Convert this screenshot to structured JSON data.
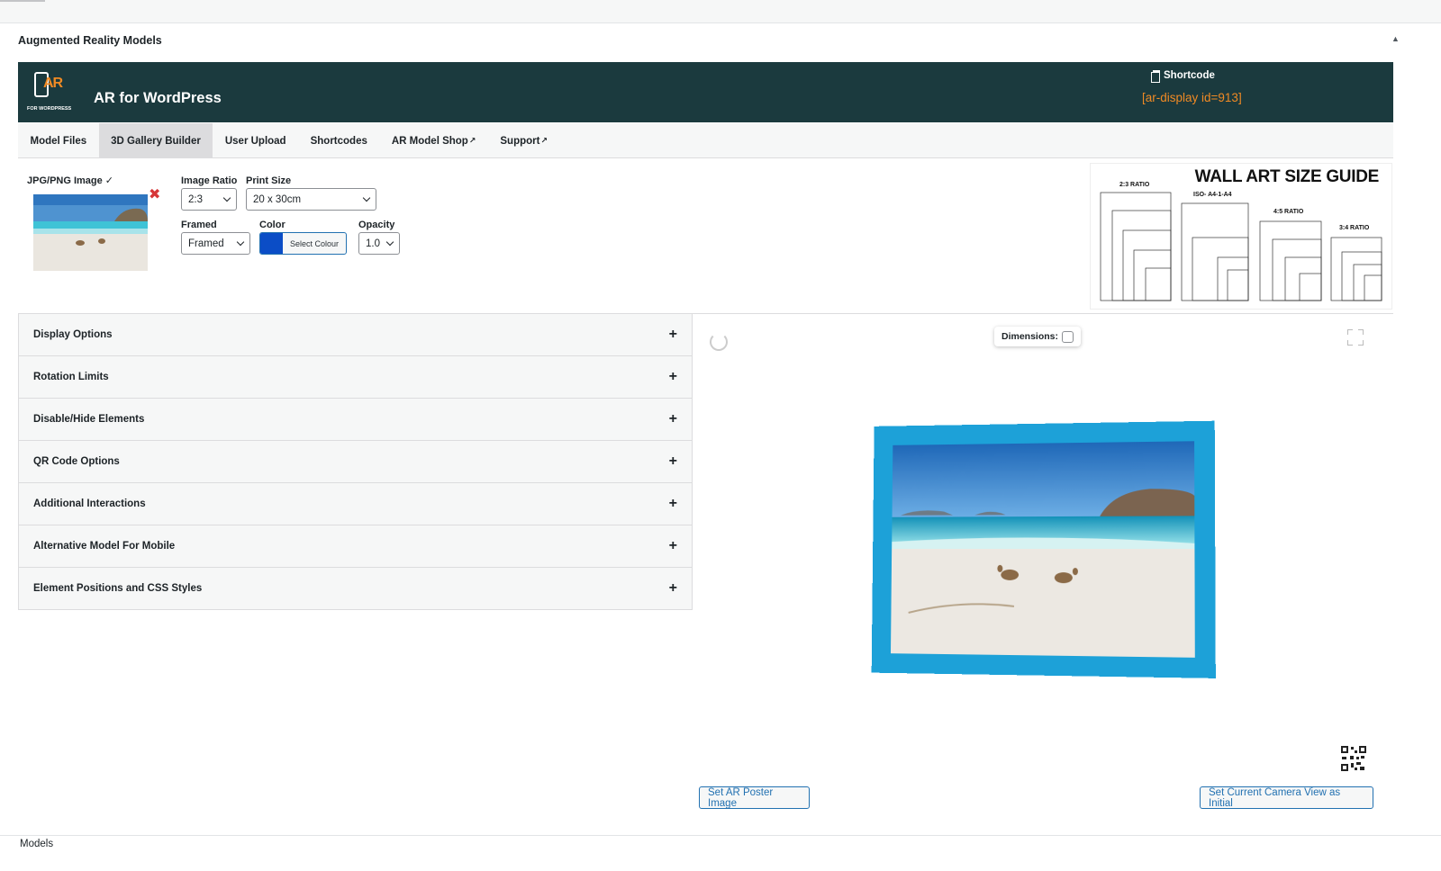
{
  "panel": {
    "title": "Augmented Reality Models",
    "collapse_icon": "triangle-up-icon"
  },
  "header": {
    "logo_text": "AR",
    "logo_sub": "FOR WORDPRESS",
    "title": "AR for WordPress",
    "shortcode_label": "Shortcode",
    "shortcode_value": "[ar-display id=913]",
    "bg_color": "#1b3a3e",
    "accent_color": "#f08a24"
  },
  "tabs": [
    {
      "label": "Model Files",
      "active": false,
      "external": false
    },
    {
      "label": "3D Gallery Builder",
      "active": true,
      "external": false
    },
    {
      "label": "User Upload",
      "active": false,
      "external": false
    },
    {
      "label": "Shortcodes",
      "active": false,
      "external": false
    },
    {
      "label": "AR Model Shop",
      "active": false,
      "external": true
    },
    {
      "label": "Support",
      "active": false,
      "external": true
    }
  ],
  "builder": {
    "image_label": "JPG/PNG Image ✓",
    "image_ratio_label": "Image Ratio",
    "image_ratio_value": "2:3",
    "print_size_label": "Print Size",
    "print_size_value": "20 x 30cm",
    "framed_label": "Framed",
    "framed_value": "Framed",
    "color_label": "Color",
    "color_button": "Select Colour",
    "color_value": "#0b4dc6",
    "opacity_label": "Opacity",
    "opacity_value": "1.0"
  },
  "guide": {
    "title": "WALL ART SIZE GUIDE",
    "sections": [
      "2:3 RATIO",
      "ISO- A4-1-A4",
      "4:5 RATIO",
      "3:4 RATIO"
    ]
  },
  "accordion": [
    "Display Options",
    "Rotation Limits",
    "Disable/Hide Elements",
    "QR Code Options",
    "Additional Interactions",
    "Alternative Model For Mobile",
    "Element Positions and CSS Styles"
  ],
  "viewer": {
    "dimensions_label": "Dimensions:",
    "frame_color": "#1da1d8",
    "poster_button": "Set AR Poster Image",
    "camera_button": "Set Current Camera View as Initial"
  },
  "footer": {
    "label": "Models"
  }
}
